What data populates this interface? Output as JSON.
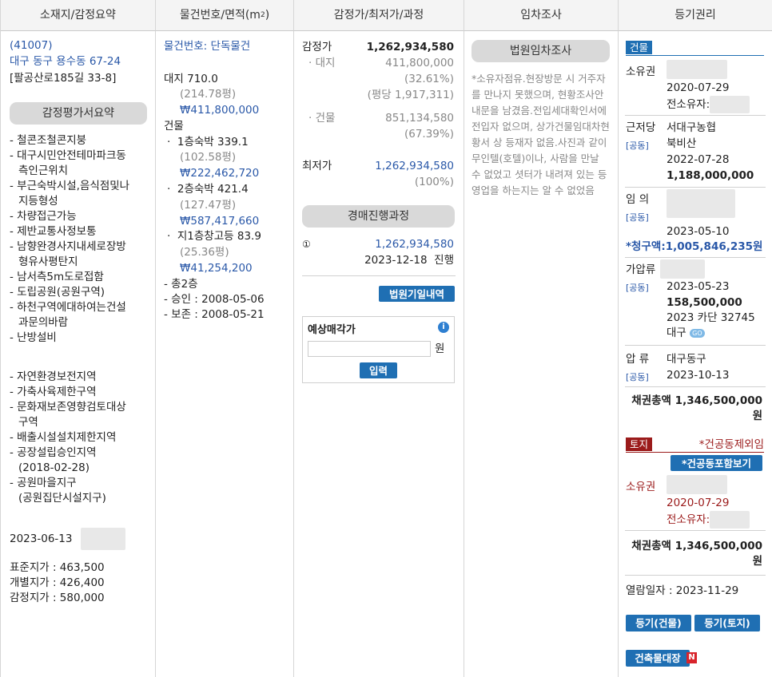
{
  "headers": [
    "소재지/감정요약",
    "물건번호/면적(m²)",
    "감정가/최저가/과정",
    "임차조사",
    "등기권리"
  ],
  "location": {
    "zip": "(41007)",
    "address": "대구 동구 용수동 67-24",
    "road": "[팔공산로185길 33-8]",
    "summary_btn": "감정평가서요약",
    "summary1": [
      "- 철콘조철콘지붕",
      "- 대구시민안전테마파크동",
      "  측인근위치",
      "- 부근숙박시설,음식점및나",
      "  지등형성",
      "- 차량접근가능",
      "- 제반교통사정보통",
      "- 남향완경사지내세로장방",
      "  형유사평탄지",
      "- 남서측5m도로접함",
      "- 도립공원(공원구역)",
      "- 하천구역에대하여는건설",
      "  과문의바람",
      "- 난방설비"
    ],
    "summary2": [
      "- 자연환경보전지역",
      "- 가축사육제한구역",
      "- 문화재보존영향검토대상",
      "  구역",
      "- 배출시설설치제한지역",
      "- 공장설립승인지역",
      "  (2018-02-28)",
      "- 공원마을지구",
      "  (공원집단시설지구)"
    ],
    "date": "2023-06-13",
    "prices": [
      "표준지가 : 463,500",
      "개별지가 : 426,400",
      "감정지가 : 580,000"
    ]
  },
  "item": {
    "number": "물건번호: 단독물건",
    "land": "대지 710.0",
    "land_py": "(214.78평)",
    "land_won": "₩411,800,000",
    "bldg": "건물",
    "floors": [
      {
        "name": "1층숙박 339.1",
        "py": "(102.58평)",
        "won": "₩222,462,720"
      },
      {
        "name": "2층숙박 421.4",
        "py": "(127.47평)",
        "won": "₩587,417,660"
      },
      {
        "name": "지1층창고등 83.9",
        "py": "(25.36평)",
        "won": "₩41,254,200"
      }
    ],
    "notes": [
      "- 총2층",
      "- 승인 : 2008-05-06",
      "- 보존 : 2008-05-21"
    ]
  },
  "appraisal": {
    "label": "감정가",
    "value": "1,262,934,580",
    "land_label": "· 대지",
    "land_value": "411,800,000",
    "land_pct": "(32.61%)",
    "land_unit": "(평당 1,917,311)",
    "bldg_label": "· 건물",
    "bldg_value": "851,134,580",
    "bldg_pct": "(67.39%)",
    "min_label": "최저가",
    "min_value": "1,262,934,580",
    "min_pct": "(100%)",
    "process_btn": "경매진행과정",
    "round_icon": "①",
    "round_value": "1,262,934,580",
    "round_date": "2023-12-18",
    "round_status": "진행",
    "court_btn": "법원기일내역",
    "expect_title": "예상매각가",
    "expect_unit": "원",
    "expect_placeholder": "",
    "enter_btn": "입력"
  },
  "tenant": {
    "btn": "법원임차조사",
    "text": "*소유자점유.현장방문 시 거주자를 만나지 못했으며, 현황조사안내문을 남겼음.전입세대확인서에 전입자 없으며, 상가건물임대차현황서 상 등재자 없음.사진과 같이 무인텔(호텔)이나, 사람을 만날 수 없었고 셧터가 내려져 있는 등 영업을 하는지는 알 수 없었음"
  },
  "registry": {
    "bldg_tag": "건물",
    "own_label": "소유권",
    "own_date": "2020-07-29",
    "own_prev": "전소유자:",
    "mort_label": "근저당",
    "mort_org1": "서대구농협",
    "mort_org2": "북비산",
    "mort_date": "2022-07-28",
    "mort_amt": "1,188,000,000",
    "common": "[공동]",
    "lease_label": "임 의",
    "lease_date": "2023-05-10",
    "lease_claim": "*청구액:1,005,846,235원",
    "prov_label": "가압류",
    "prov_date": "2023-05-23",
    "prov_amt": "158,500,000",
    "prov_case": "2023 카단 32745",
    "prov_court": "대구",
    "go": "GO",
    "seize_label": "압 류",
    "seize_org": "대구동구",
    "seize_date": "2023-10-13",
    "total1": "채권총액 1,346,500,000",
    "won": "원",
    "land_tag": "토지",
    "land_excl": "*건공동제외임",
    "land_btn": "*건공동포함보기",
    "own2_label": "소유권",
    "own2_date": "2020-07-29",
    "own2_prev": "전소유자:",
    "total2": "채권총액 1,346,500,000",
    "view_date": "열람일자 : 2023-11-29",
    "reg_bldg_btn": "등기(건물)",
    "reg_land_btn": "등기(토지)",
    "ledger_btn": "건축물대장",
    "new_badge": "N"
  }
}
